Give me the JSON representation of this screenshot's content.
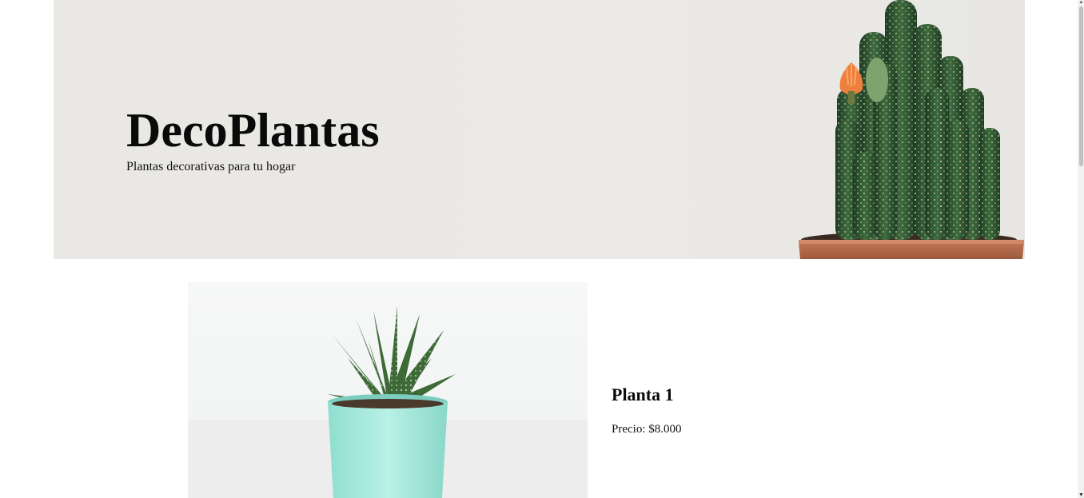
{
  "hero": {
    "title": "DecoPlantas",
    "subtitle": "Plantas decorativas para tu hogar",
    "image_icon": "cactus-pot-image"
  },
  "products": [
    {
      "name": "Planta 1",
      "price": "Precio: $8.000",
      "image_icon": "succulent-pot-image"
    }
  ],
  "colors": {
    "hero_background": "#e9e8e4",
    "pot_terracotta": "#b56a4a",
    "pot_mint": "#9fe5d8",
    "text": "#0a0a0a"
  }
}
